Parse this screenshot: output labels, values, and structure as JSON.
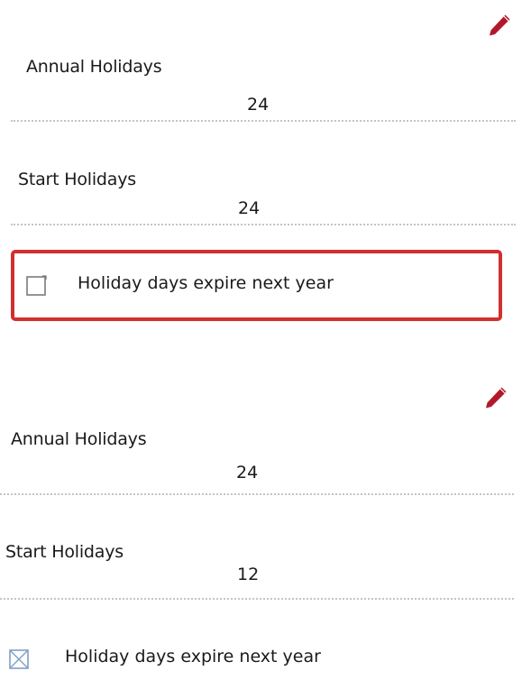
{
  "top_card": {
    "annual_label": "Annual Holidays",
    "annual_value": "24",
    "start_label": "Start Holidays",
    "start_value": "24",
    "checkbox_label": "Holiday days expire next year",
    "checkbox_checked": false,
    "highlight_color": "#d32f2f"
  },
  "bottom_card": {
    "annual_label": "Annual Holidays",
    "annual_value": "24",
    "start_label": "Start Holidays",
    "start_value": "12",
    "checkbox_label": "Holiday days expire next year",
    "checkbox_checked": true
  },
  "icons": {
    "edit": "pencil-icon",
    "checkbox_unchecked": "checkbox-unchecked-icon",
    "checkbox_checked": "checkbox-checked-icon"
  },
  "colors": {
    "edit_icon": "#b3182a",
    "divider": "#c4c4c4"
  }
}
